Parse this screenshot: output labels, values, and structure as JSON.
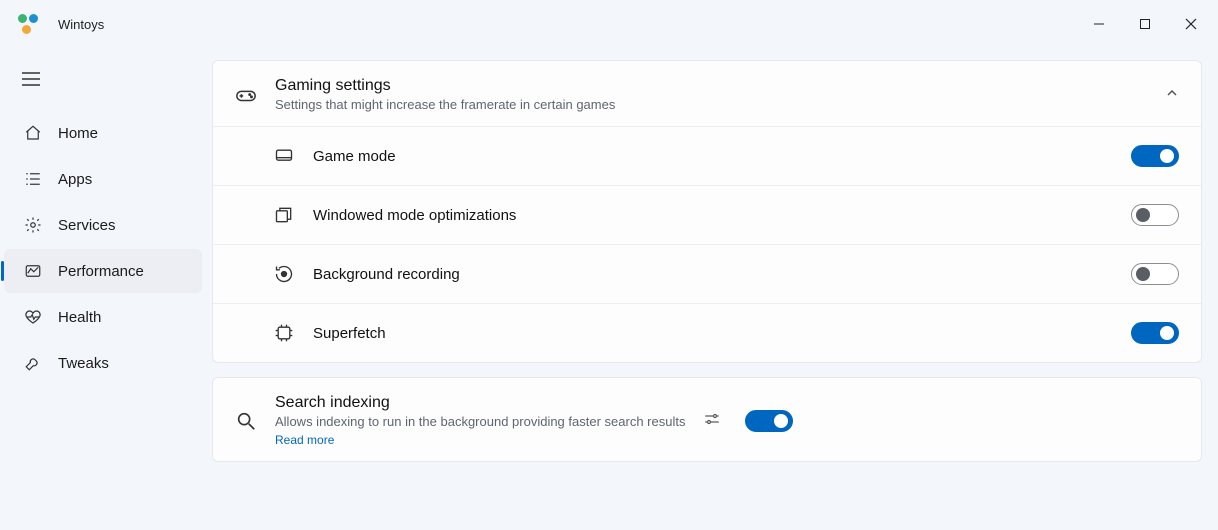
{
  "app": {
    "title": "Wintoys"
  },
  "sidebar": {
    "items": [
      {
        "label": "Home"
      },
      {
        "label": "Apps"
      },
      {
        "label": "Services"
      },
      {
        "label": "Performance"
      },
      {
        "label": "Health"
      },
      {
        "label": "Tweaks"
      }
    ],
    "active_index": 3
  },
  "gaming": {
    "title": "Gaming settings",
    "subtitle": "Settings that might increase the framerate in certain games",
    "rows": [
      {
        "label": "Game mode",
        "on": true
      },
      {
        "label": "Windowed mode optimizations",
        "on": false
      },
      {
        "label": "Background recording",
        "on": false
      },
      {
        "label": "Superfetch",
        "on": true
      }
    ]
  },
  "search_indexing": {
    "title": "Search indexing",
    "subtitle": "Allows indexing to run in the background providing faster search results",
    "read_more": "Read more",
    "on": true
  }
}
